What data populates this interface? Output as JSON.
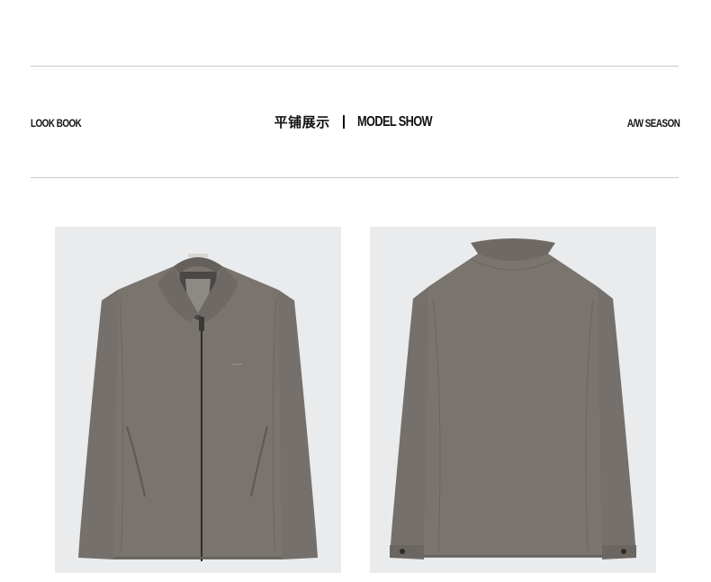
{
  "header": {
    "left_label": "LOOK BOOK",
    "title_cn": "平铺展示",
    "title_en": "MODEL SHOW",
    "right_label": "A/W SEASON"
  },
  "products": [
    {
      "view": "front",
      "icon": "jacket-front-image"
    },
    {
      "view": "back",
      "icon": "jacket-back-image"
    }
  ],
  "colors": {
    "jacket": "#7a746f",
    "jacket_shadow": "#65605b",
    "photo_bg": "#e9ebed",
    "rule": "#c9c9c9",
    "text": "#111111"
  }
}
